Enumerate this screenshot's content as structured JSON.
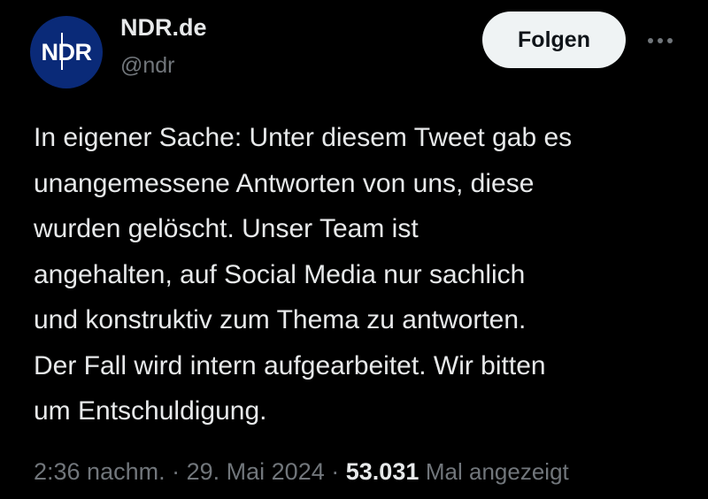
{
  "author": {
    "display_name": "NDR.de",
    "handle": "@ndr",
    "avatar_logo": "NDR",
    "avatar_color": "#0a2a78"
  },
  "follow_button": {
    "label": "Folgen"
  },
  "more_icon": "more-horizontal-icon",
  "tweet_lines": [
    "In eigener Sache: Unter diesem Tweet gab es",
    "unangemessene Antworten von uns, diese",
    "wurden gelöscht. Unser Team ist",
    "angehalten, auf Social Media nur sachlich",
    "und konstruktiv zum Thema zu antworten.",
    "Der Fall wird intern aufgearbeitet. Wir bitten",
    "um Entschuldigung."
  ],
  "meta": {
    "time": "2:36 nachm.",
    "separator": "·",
    "date": "29. Mai 2024",
    "views_count": "53.031",
    "views_label": "Mal angezeigt"
  },
  "colors": {
    "background": "#000000",
    "primary_text": "#e7e9ea",
    "secondary_text": "#71767b",
    "follow_bg": "#eff3f4"
  }
}
